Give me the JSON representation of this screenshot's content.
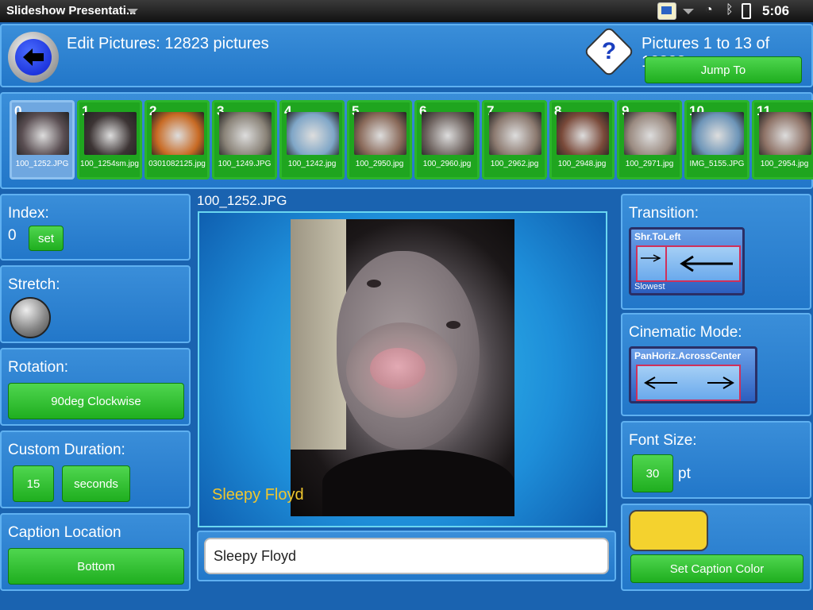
{
  "status_bar": {
    "app_title": "Slideshow Presentati...",
    "time": "5:06"
  },
  "header": {
    "title": "Edit Pictures: 12823 pictures",
    "range": "Pictures 1 to 13 of 12823",
    "jump_label": "Jump To",
    "help_glyph": "?"
  },
  "filmstrip": [
    {
      "num": "0",
      "name": "100_1252.JPG",
      "color": "#5a4e52"
    },
    {
      "num": "1",
      "name": "100_1254sm.jpg",
      "color": "#3c3434"
    },
    {
      "num": "2",
      "name": "0301082125.jpg",
      "color": "#c86a24"
    },
    {
      "num": "3",
      "name": "100_1249.JPG",
      "color": "#8a8378"
    },
    {
      "num": "4",
      "name": "100_1242.jpg",
      "color": "#7fa6c7"
    },
    {
      "num": "5",
      "name": "100_2950.jpg",
      "color": "#8a6a5a"
    },
    {
      "num": "6",
      "name": "100_2960.jpg",
      "color": "#6f6460"
    },
    {
      "num": "7",
      "name": "100_2962.jpg",
      "color": "#8c7a70"
    },
    {
      "num": "8",
      "name": "100_2948.jpg",
      "color": "#7a4a3a"
    },
    {
      "num": "9",
      "name": "100_2971.jpg",
      "color": "#9a8a80"
    },
    {
      "num": "10",
      "name": "IMG_5155.JPG",
      "color": "#6d95b8"
    },
    {
      "num": "11",
      "name": "100_2954.jpg",
      "color": "#8e7266"
    }
  ],
  "left": {
    "index_label": "Index:",
    "index_value": "0",
    "set_label": "set",
    "stretch_label": "Stretch:",
    "rotation_label": "Rotation:",
    "rotation_value": "90deg Clockwise",
    "duration_label": "Custom Duration:",
    "duration_value": "15",
    "duration_unit": "seconds",
    "caption_location_label": "Caption Location",
    "caption_location_value": "Bottom"
  },
  "center": {
    "filename": "100_1252.JPG",
    "caption_overlay": "Sleepy Floyd",
    "caption_input": "Sleepy Floyd"
  },
  "right": {
    "transition_label": "Transition:",
    "transition_name": "Shr.ToLeft",
    "transition_speed": "Slowest",
    "cinematic_label": "Cinematic Mode:",
    "cinematic_name": "PanHoriz.AcrossCenter",
    "font_size_label": "Font Size:",
    "font_size_value": "30",
    "font_size_unit": "pt",
    "caption_color": "#f4d22e",
    "set_color_label": "Set Caption Color"
  }
}
